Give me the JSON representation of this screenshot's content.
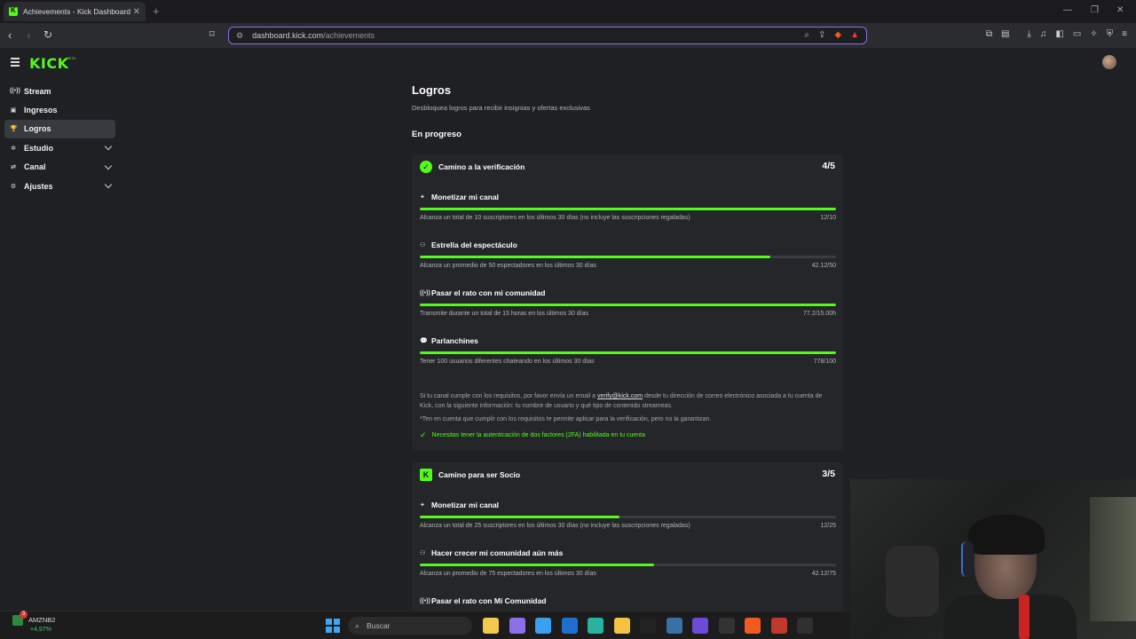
{
  "browser": {
    "tab_title": "Achievements - Kick Dashboard",
    "tab_close": "✕",
    "new_tab": "+",
    "url_host": "dashboard.kick.com",
    "url_path": "/achievements",
    "window_controls": [
      "—",
      "❐",
      "✕"
    ]
  },
  "app": {
    "logo": "KICK",
    "logo_badge": "BETA"
  },
  "sidebar": {
    "items": [
      {
        "label": "Stream",
        "icon": "broadcast-icon",
        "glyph": "((•))"
      },
      {
        "label": "Ingresos",
        "icon": "revenue-icon",
        "glyph": "▣"
      },
      {
        "label": "Logros",
        "icon": "trophy-icon",
        "glyph": "🏆"
      },
      {
        "label": "Estudio",
        "icon": "studio-icon",
        "glyph": "✲"
      },
      {
        "label": "Canal",
        "icon": "channel-icon",
        "glyph": "⇄"
      },
      {
        "label": "Ajustes",
        "icon": "gear-icon",
        "glyph": "⚙"
      }
    ]
  },
  "page": {
    "title": "Logros",
    "subtitle": "Desbloquea logros para recibir insignias y ofertas exclusivas",
    "section": "En progreso"
  },
  "verification": {
    "title": "Camino a la verificación",
    "count": "4/5",
    "achievements": [
      {
        "title": "Monetizar mi canal",
        "icon": "sparkle-icon",
        "glyph": "✦",
        "desc": "Alcanza un total de 10 suscriptores en los últimos 30 días (no incluye las suscripciones regaladas)",
        "value": "12/10",
        "progress": 1.0
      },
      {
        "title": "Estrella del espectáculo",
        "icon": "users-icon",
        "glyph": "⚇",
        "desc": "Alcanza un promedio de 50 espectadores en los últimos 30 días",
        "value": "42.12/50",
        "progress": 0.842
      },
      {
        "title": "Pasar el rato con mi comunidad",
        "icon": "broadcast-icon",
        "glyph": "((•))",
        "desc": "Transmite durante un total de 15 horas en los últimos 30 días",
        "value": "77.2/15.00h",
        "progress": 1.0
      },
      {
        "title": "Parlanchines",
        "icon": "chat-icon",
        "glyph": "💬",
        "desc": "Tener 100 usuarios diferentes chateando en los últimos 30 días",
        "value": "778/100",
        "progress": 1.0
      }
    ],
    "note_pre": "Si tu canal cumple con los requisitos, por favor envía un email a ",
    "note_email": "verify@kick.com",
    "note_post": " desde tu dirección de correo electrónico asociada a tu cuenta de Kick, con la siguiente información: tu nombre de usuario y qué tipo de contenido streameas.",
    "note_disclaimer": "*Ten en cuenta que cumplir con los requisitos te permite aplicar para la verificación, pero no la garantizan.",
    "twofa": "Necesitas tener la autenticación de dos factores (2FA) habilitada en tu cuenta"
  },
  "partner": {
    "title": "Camino para ser Socio",
    "count": "3/5",
    "achievements": [
      {
        "title": "Monetizar mi canal",
        "icon": "sparkle-icon",
        "glyph": "✦",
        "desc": "Alcanza un total de 25 suscriptores en los últimos 30 días (no incluye las suscripciones regaladas)",
        "value": "12/25",
        "progress": 0.48
      },
      {
        "title": "Hacer crecer mi comunidad aún más",
        "icon": "users-icon",
        "glyph": "⚇",
        "desc": "Alcanza un promedio de 75 espectadores en los últimos 30 días",
        "value": "42.12/75",
        "progress": 0.562
      },
      {
        "title": "Pasar el rato con Mi Comunidad",
        "icon": "broadcast-icon",
        "glyph": "((•))"
      }
    ]
  },
  "taskbar": {
    "ticker_name": "AMZNB2",
    "ticker_change": "+4,97%",
    "ticker_badge": "3",
    "search_placeholder": "Buscar",
    "apps": [
      {
        "name": "file-explorer-icon",
        "color": "#f2c94c"
      },
      {
        "name": "copilot-icon",
        "color": "#8c6fe8"
      },
      {
        "name": "store-icon",
        "color": "#3aa0f0"
      },
      {
        "name": "outlook-icon",
        "color": "#1f6fd1"
      },
      {
        "name": "edge-icon",
        "color": "#28b3a1"
      },
      {
        "name": "folder-icon",
        "color": "#f5c242"
      },
      {
        "name": "tiktok-icon",
        "color": "#222"
      },
      {
        "name": "calculator-icon",
        "color": "#3b6fa8"
      },
      {
        "name": "proton-icon",
        "color": "#6d4ad9"
      },
      {
        "name": "mm-app-icon",
        "color": "#333"
      },
      {
        "name": "brave-icon",
        "color": "#f25a22"
      },
      {
        "name": "video-app-icon",
        "color": "#c0392b"
      },
      {
        "name": "obs-icon",
        "color": "#303030"
      }
    ]
  }
}
